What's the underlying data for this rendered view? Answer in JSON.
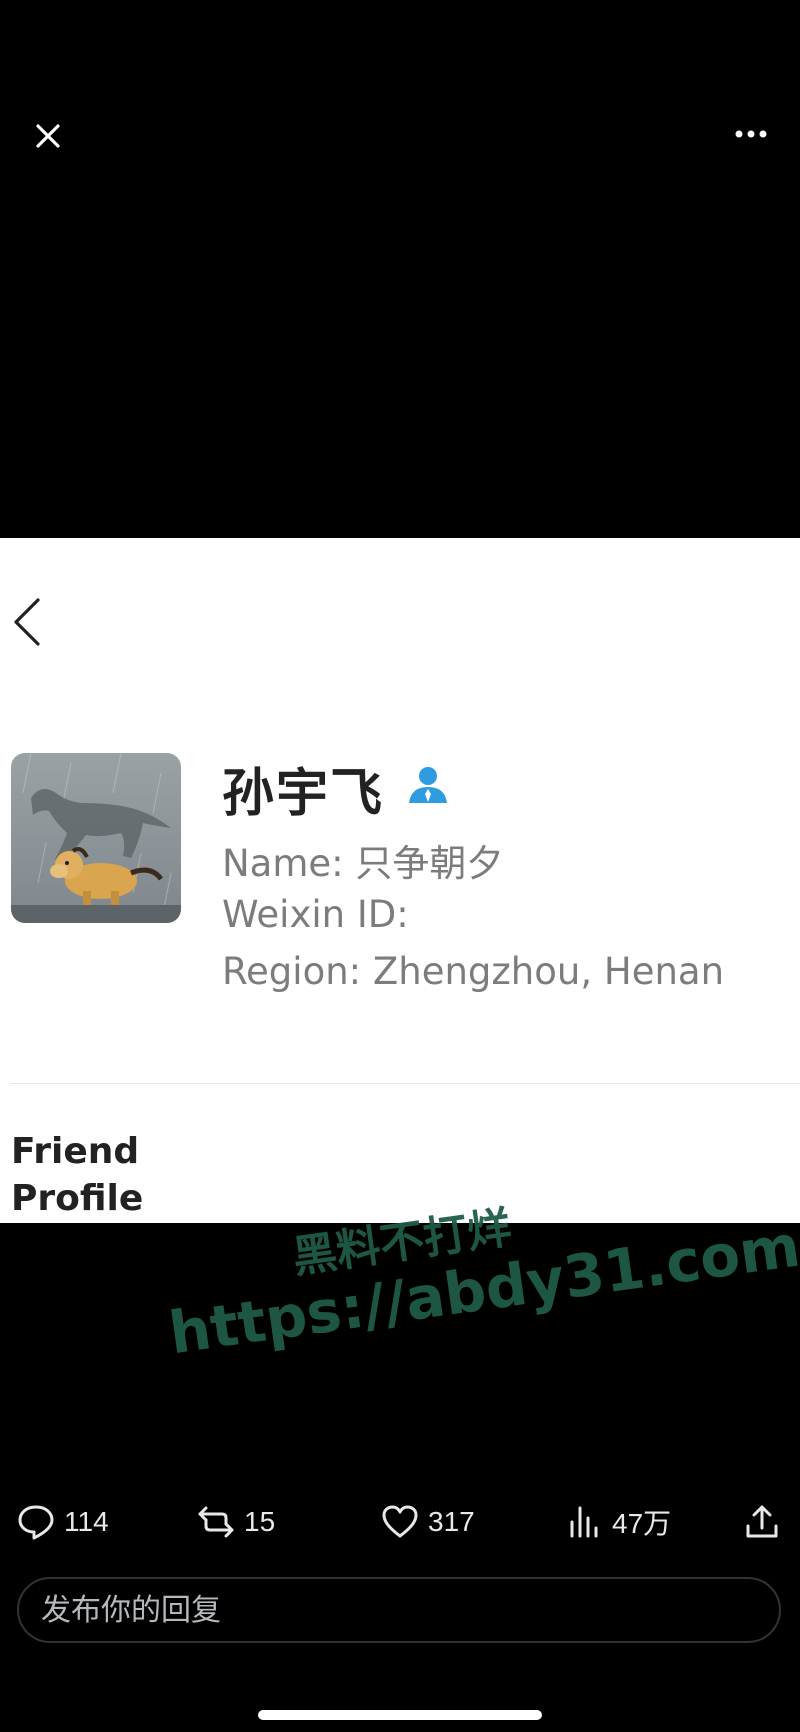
{
  "topbar": {
    "close_icon": "close-icon",
    "more_icon": "more-horizontal-icon"
  },
  "embedded_screenshot": {
    "back_icon": "chevron-left-icon",
    "display_name": "孙宇飞",
    "verify_icon": "contact-person-icon",
    "name_line": "Name: 只争朝夕",
    "weixin_line": "Weixin ID:",
    "region_line": "Region: Zhengzhou, Henan",
    "section_title_1": "Friend",
    "section_title_2": "Profile",
    "avatar_description_icon": "horse-avatar"
  },
  "watermark": {
    "line1": "黑料不打烊",
    "line2": "https://abdy31.com",
    "color": "#1f5c47"
  },
  "actions": {
    "replies": "114",
    "retweets": "15",
    "likes": "317",
    "views": "47万"
  },
  "reply": {
    "placeholder": "发布你的回复"
  },
  "colors": {
    "background": "#000000",
    "card": "#ffffff",
    "verify": "#2f9be0",
    "icon": "#e7e9ea"
  }
}
